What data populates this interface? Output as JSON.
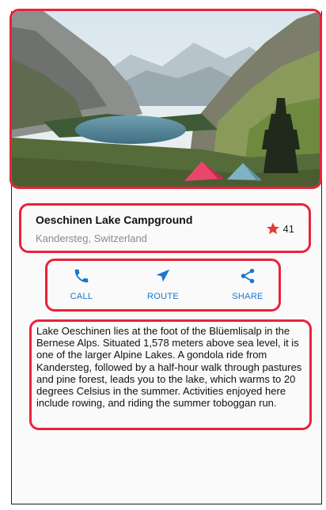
{
  "place": {
    "title": "Oeschinen Lake Campground",
    "location": "Kandersteg, Switzerland",
    "rating_count": "41",
    "star_color": "#e53935"
  },
  "actions": [
    {
      "label": "CALL",
      "icon": "phone-icon"
    },
    {
      "label": "ROUTE",
      "icon": "navigation-arrow-icon"
    },
    {
      "label": "SHARE",
      "icon": "share-icon"
    }
  ],
  "accent_color": "#1976d2",
  "description": "Lake Oeschinen lies at the foot of the Blüemlisalp in the Bernese Alps. Situated 1,578 meters above sea level, it is one of the larger Alpine Lakes. A gondola ride from Kandersteg, followed by a half-hour walk through pastures and pine forest, leads you to the lake, which warms to 20 degrees Celsius in the summer. Activities enjoyed here include rowing, and riding the summer toboggan run."
}
